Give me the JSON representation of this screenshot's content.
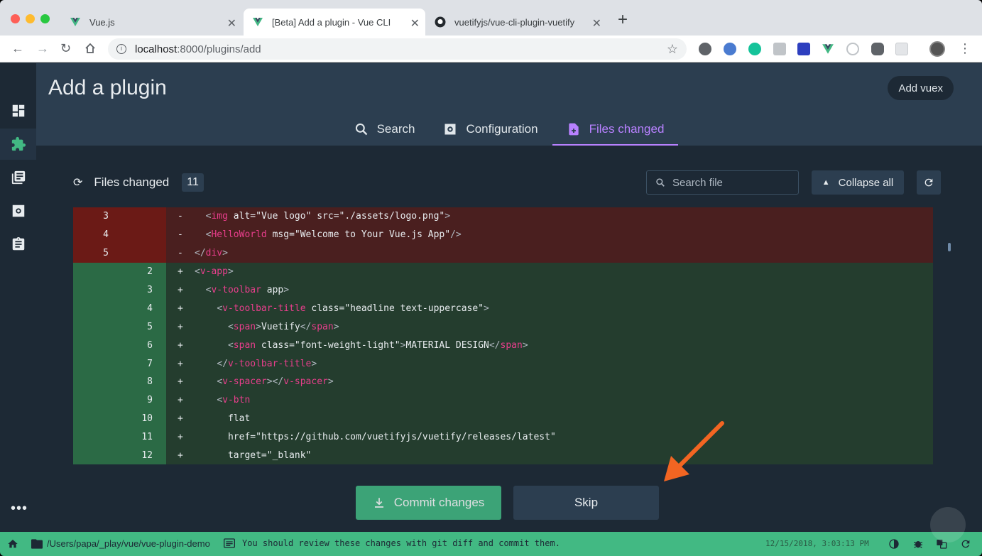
{
  "browser": {
    "tabs": [
      {
        "title": "Vue.js",
        "active": false
      },
      {
        "title": "[Beta] Add a plugin - Vue CLI",
        "active": true
      },
      {
        "title": "vuetifyjs/vue-cli-plugin-vuetify",
        "active": false
      }
    ],
    "url_host": "localhost",
    "url_path": ":8000/plugins/add",
    "info_icon": "i"
  },
  "page": {
    "title": "Add a plugin",
    "header_button": "Add vuex",
    "tabs": [
      {
        "label": "Search",
        "icon": "search-icon"
      },
      {
        "label": "Configuration",
        "icon": "settings-box-icon"
      },
      {
        "label": "Files changed",
        "icon": "file-plus-icon",
        "active": true
      }
    ]
  },
  "sidebar": {
    "items": [
      {
        "name": "dashboard",
        "icon": "dashboard-icon"
      },
      {
        "name": "plugins",
        "icon": "puzzle-icon",
        "active": true
      },
      {
        "name": "dependencies",
        "icon": "library-books-icon"
      },
      {
        "name": "configuration",
        "icon": "settings-icon"
      },
      {
        "name": "tasks",
        "icon": "clipboard-icon"
      }
    ],
    "more": "•••"
  },
  "files": {
    "heading": "Files changed",
    "count": "11",
    "search_placeholder": "Search file",
    "collapse_label": "Collapse all"
  },
  "diff": {
    "removed": [
      {
        "line": "3",
        "sign": "-",
        "indent": "  ",
        "tag": "img",
        "attrs": [
          [
            "alt",
            "\"Vue logo\""
          ],
          [
            "src",
            "\"./assets/logo.png\""
          ]
        ],
        "close": ">"
      },
      {
        "line": "4",
        "sign": "-",
        "indent": "  ",
        "tag": "HelloWorld",
        "attrs": [
          [
            "msg",
            "\"Welcome to Your Vue.js App\""
          ]
        ],
        "close": "/>"
      },
      {
        "line": "5",
        "sign": "-",
        "indent": "",
        "tag": "/div",
        "attrs": [],
        "close": ">"
      }
    ],
    "added": [
      {
        "line": "2",
        "sign": "+",
        "text": "<v-app>"
      },
      {
        "line": "3",
        "sign": "+",
        "text": "  <v-toolbar app>"
      },
      {
        "line": "4",
        "sign": "+",
        "text": "    <v-toolbar-title class=\"headline text-uppercase\">"
      },
      {
        "line": "5",
        "sign": "+",
        "text": "      <span>Vuetify</span>"
      },
      {
        "line": "6",
        "sign": "+",
        "text": "      <span class=\"font-weight-light\">MATERIAL DESIGN</span>"
      },
      {
        "line": "7",
        "sign": "+",
        "text": "    </v-toolbar-title>"
      },
      {
        "line": "8",
        "sign": "+",
        "text": "    <v-spacer></v-spacer>"
      },
      {
        "line": "9",
        "sign": "+",
        "text": "    <v-btn"
      },
      {
        "line": "10",
        "sign": "+",
        "text": "      flat"
      },
      {
        "line": "11",
        "sign": "+",
        "text": "      href=\"https://github.com/vuetifyjs/vuetify/releases/latest\""
      },
      {
        "line": "12",
        "sign": "+",
        "text": "      target=\"_blank\""
      }
    ]
  },
  "actions": {
    "commit": "Commit changes",
    "skip": "Skip"
  },
  "statusbar": {
    "folder": "/Users/papa/_play/vue/vue-plugin-demo",
    "message": "You should review these changes with git diff and commit them.",
    "time": "12/15/2018, 3:03:13 PM"
  },
  "colors": {
    "accent": "#42b983",
    "purple": "#b881ff",
    "bg": "#1d2935",
    "header": "#2c3e50",
    "arrow": "#f26522"
  }
}
